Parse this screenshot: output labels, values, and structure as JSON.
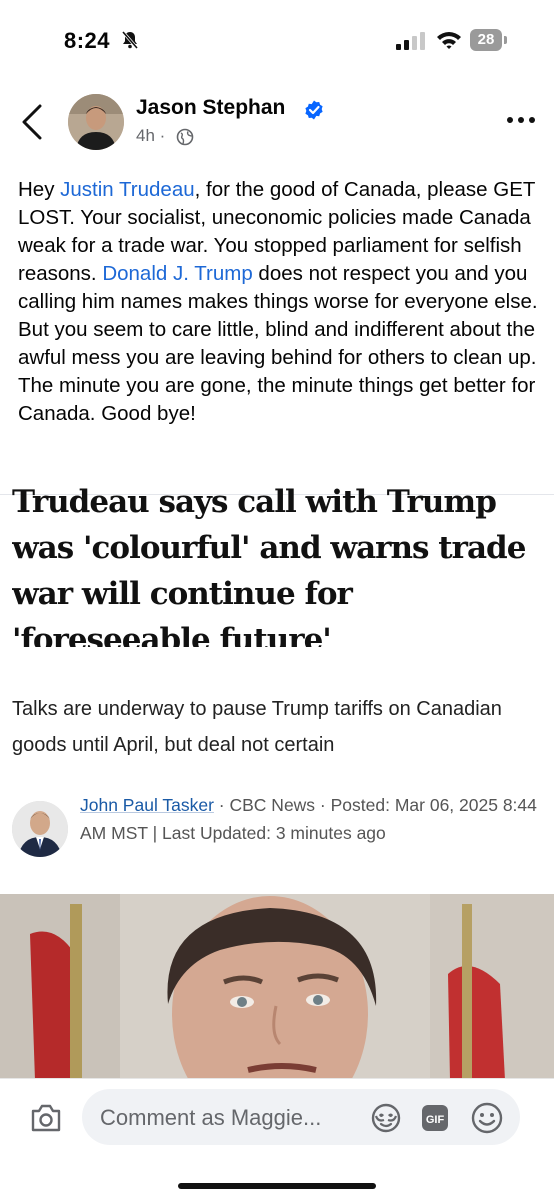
{
  "status_bar": {
    "time": "8:24",
    "battery": "28"
  },
  "post": {
    "author": "Jason Stephan",
    "time": "4h",
    "separator": "·",
    "text_segments": [
      {
        "text": "Hey ",
        "mention": false
      },
      {
        "text": "Justin Trudeau",
        "mention": true
      },
      {
        "text": ", for the good of Canada, please GET LOST.  Your socialist, uneconomic policies made Canada weak for a trade war.  You stopped parliament for selfish reasons.  ",
        "mention": false
      },
      {
        "text": "Donald J. Trump",
        "mention": true
      },
      {
        "text": " does not respect you and you calling him names makes things worse for everyone else.  But you seem to care little, blind and indifferent about the awful mess you are leaving behind for others to clean up.   The minute you are gone, the minute things get better for Canada.  Good bye!",
        "mention": false
      }
    ]
  },
  "article": {
    "headline": "Trudeau says call with Trump was 'colourful' and warns trade war will continue for 'foreseeable future'",
    "deck": "Talks are underway to pause Trump tariffs on Canadian goods until April, but deal not certain",
    "byline_author": "John Paul Tasker",
    "byline_outlet": " · CBC News · ",
    "byline_posted": "Posted: Mar 06, 2025 8:44 AM MST | Last Updated: 3 minutes ago"
  },
  "comment_bar": {
    "placeholder": "Comment as Maggie..."
  },
  "colors": {
    "link": "#1d68d6",
    "verified": "#0866ff",
    "muted": "#65676b"
  },
  "icons": [
    "bell-slash-icon",
    "signal-icon",
    "wifi-icon",
    "back-icon",
    "verified-icon",
    "globe-icon",
    "more-icon",
    "camera-icon",
    "avatar-sticker-icon",
    "gif-icon",
    "emoji-icon"
  ]
}
